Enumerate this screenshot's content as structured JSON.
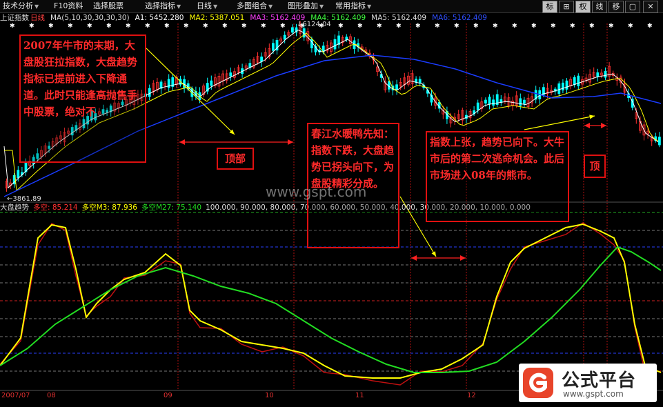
{
  "toolbar": {
    "tabs": [
      "技术分析",
      "F10资料",
      "选择股票",
      "选择指标",
      "日线",
      "多图组合",
      "图形叠加",
      "常用指标"
    ],
    "right_buttons": [
      "标",
      "⊞",
      "权",
      "线",
      "移",
      "▢",
      "✕"
    ]
  },
  "ma_line": {
    "index_name": "上证指数",
    "period": "日线",
    "ma_params": "MA(5,10,30,30,30,30)",
    "ma1": "A1: 5452.280",
    "ma2": "MA2: 5387.051",
    "ma3": "MA3: 5162.409",
    "ma4": "MA4: 5162.409",
    "ma5": "MA5: 5162.409",
    "ma6": "MA6: 5162.409"
  },
  "price_labels": {
    "high": "6124.04",
    "low": "3861.89"
  },
  "indicator_header": {
    "name": "大盘趋势",
    "short": "多空: 85.214",
    "m3": "多空M3: 87.936",
    "m27": "多空M27: 75.140",
    "levels": "100.000, 90.000, 80.000, 70.000, 60.000, 50.000, 40.000, 30.000, 20.000, 10.000, 0.000"
  },
  "annotations": {
    "note1": "2007年牛市的末期，大盘股狂拉指数，大盘趋势指标已提前进入下降通道。此时只能逢高抛售手中股票，绝对不",
    "note2": "春江水暖鸭先知：指数下跌，大盘趋势已拐头向下，为盘股精彩分成。",
    "note3": "指数上张，趋势已向下。大牛市后的第二次逃命机会。此后市场进入08年的熊市。",
    "tag_top1": "顶部",
    "tag_top2": "顶"
  },
  "x_axis": [
    "2007/07",
    "08",
    "09",
    "10",
    "11",
    "12"
  ],
  "watermark": "www.gspt.com",
  "logo": {
    "name": "公式平台",
    "url": "www.gspt.com"
  },
  "colors": {
    "up_candle": "#ff3030",
    "down_candle": "#00ffff",
    "ma_fast": "#ffffff",
    "ma_mid": "#ffff00",
    "ma_slow": "#1a3cff",
    "ind_short": "#ffff00",
    "ind_mid": "#c01010",
    "ind_long": "#22dd22",
    "note_red": "#ff2a2a"
  }
}
